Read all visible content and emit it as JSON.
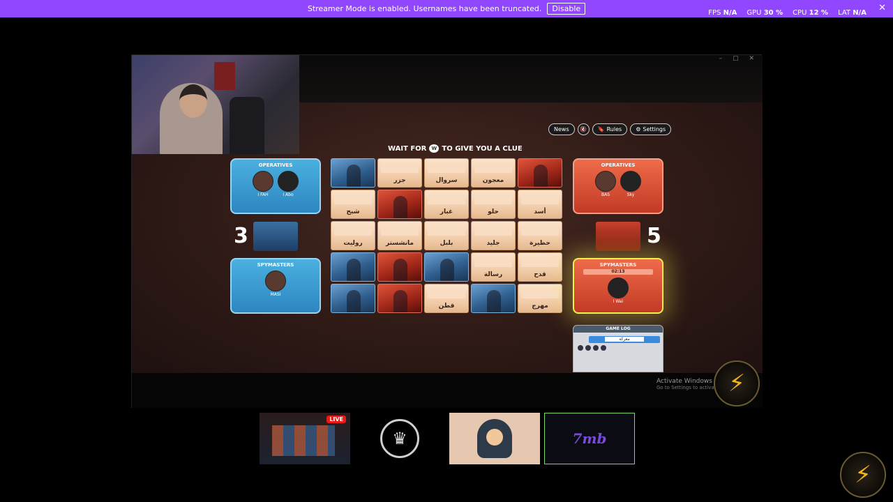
{
  "topbar": {
    "message": "Streamer Mode is enabled. Usernames have been truncated.",
    "disable_label": "Disable",
    "stats": [
      {
        "label": "FPS",
        "value": "N/A"
      },
      {
        "label": "GPU",
        "value": "30 %"
      },
      {
        "label": "CPU",
        "value": "12 %"
      },
      {
        "label": "LAT",
        "value": "N/A"
      }
    ],
    "close_glyph": "✕"
  },
  "window": {
    "controls": "– ▢ ✕"
  },
  "game": {
    "buttons": {
      "news": "News",
      "rules": "Rules",
      "settings": "Settings"
    },
    "clue_prefix": "WAIT FOR",
    "clue_suffix": "TO GIVE YOU A CLUE",
    "blue_team": {
      "operatives_title": "OPERATIVES",
      "operatives": [
        "I FAH",
        "I Abo"
      ],
      "spymasters_title": "SPYMASTERS",
      "spymasters": [
        "MASI"
      ],
      "score": "3"
    },
    "red_team": {
      "operatives_title": "OPERATIVES",
      "operatives": [
        "BAS",
        "Sky"
      ],
      "spymasters_title": "SPYMASTERS",
      "timer": "02:13",
      "spymasters": [
        "I Wai"
      ],
      "score": "5"
    },
    "board": [
      {
        "type": "blue",
        "word": ""
      },
      {
        "type": "word",
        "word": "جزر"
      },
      {
        "type": "word",
        "word": "سروال"
      },
      {
        "type": "word",
        "word": "معجون"
      },
      {
        "type": "red",
        "word": ""
      },
      {
        "type": "word",
        "word": "شبح"
      },
      {
        "type": "red",
        "word": ""
      },
      {
        "type": "word",
        "word": "غبار"
      },
      {
        "type": "word",
        "word": "حلو"
      },
      {
        "type": "word",
        "word": "أسد"
      },
      {
        "type": "word",
        "word": "روليت"
      },
      {
        "type": "word",
        "word": "مانشستر"
      },
      {
        "type": "word",
        "word": "بلبل"
      },
      {
        "type": "word",
        "word": "جليد"
      },
      {
        "type": "word",
        "word": "حظيرة"
      },
      {
        "type": "blue",
        "word": ""
      },
      {
        "type": "red",
        "word": ""
      },
      {
        "type": "blue",
        "word": ""
      },
      {
        "type": "word",
        "word": "رسالة"
      },
      {
        "type": "word",
        "word": "قدح"
      },
      {
        "type": "blue",
        "word": ""
      },
      {
        "type": "red",
        "word": ""
      },
      {
        "type": "word",
        "word": "قطن"
      },
      {
        "type": "blue",
        "word": ""
      },
      {
        "type": "word",
        "word": "مهرج"
      }
    ],
    "game_log": {
      "title": "GAME LOG",
      "entry": "معركة"
    }
  },
  "activate": {
    "title": "Activate Windows",
    "subtitle": "Go to Settings to activate"
  },
  "thumbnails": {
    "live_label": "LIVE",
    "zmb_label": "7mb"
  }
}
